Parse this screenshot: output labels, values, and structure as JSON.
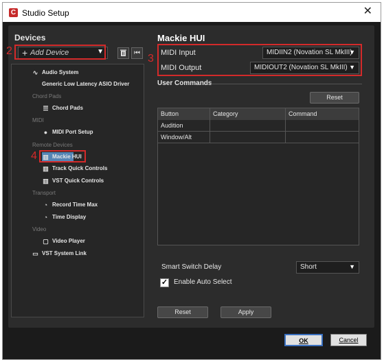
{
  "window": {
    "title": "Studio Setup",
    "app_icon_glyph": "C"
  },
  "devices": {
    "label": "Devices",
    "add_device": "Add Device",
    "tree": [
      {
        "kind": "item",
        "label": "Audio System",
        "icon": "audio-wave-icon"
      },
      {
        "kind": "sub",
        "label": "Generic Low Latency ASIO Driver"
      },
      {
        "kind": "group",
        "label": "Chord Pads"
      },
      {
        "kind": "item",
        "label": "Chord Pads",
        "icon": "chord-pads-icon"
      },
      {
        "kind": "group",
        "label": "MIDI"
      },
      {
        "kind": "item",
        "label": "MIDI Port Setup",
        "icon": "midi-port-icon"
      },
      {
        "kind": "group",
        "label": "Remote Devices"
      },
      {
        "kind": "item",
        "label": "Mackie HUI",
        "icon": "keyboard-icon",
        "selected": true
      },
      {
        "kind": "item",
        "label": "Track Quick Controls",
        "icon": "keyboard-icon"
      },
      {
        "kind": "item",
        "label": "VST Quick Controls",
        "icon": "keyboard-icon"
      },
      {
        "kind": "group",
        "label": "Transport"
      },
      {
        "kind": "item",
        "label": "Record Time Max",
        "icon": "clock-icon"
      },
      {
        "kind": "item",
        "label": "Time Display",
        "icon": "clock-icon"
      },
      {
        "kind": "group",
        "label": "Video"
      },
      {
        "kind": "item",
        "label": "Video Player",
        "icon": "video-icon"
      },
      {
        "kind": "item",
        "label": "VST System Link",
        "icon": "monitor-icon"
      }
    ]
  },
  "detail": {
    "title": "Mackie HUI",
    "midi_input_label": "MIDI Input",
    "midi_input_value": "MIDIIN2 (Novation SL MkIII)",
    "midi_output_label": "MIDI Output",
    "midi_output_value": "MIDIOUT2 (Novation SL MkIII)",
    "user_commands_label": "User Commands",
    "reset_top": "Reset",
    "table": {
      "headers": [
        "Button",
        "Category",
        "Command"
      ],
      "rows": [
        [
          "Audition",
          "",
          ""
        ],
        [
          "Window/Alt",
          "",
          ""
        ]
      ]
    },
    "smart_switch_label": "Smart Switch Delay",
    "smart_switch_value": "Short",
    "enable_auto_select": "Enable Auto Select",
    "reset_bottom": "Reset",
    "apply": "Apply"
  },
  "annotations": {
    "n2": "2",
    "n3": "3",
    "n4": "4"
  },
  "footer": {
    "ok": "OK",
    "cancel": "Cancel"
  },
  "colors": {
    "annotation_red": "#d42a2a",
    "selection_blue": "#5585b5"
  }
}
